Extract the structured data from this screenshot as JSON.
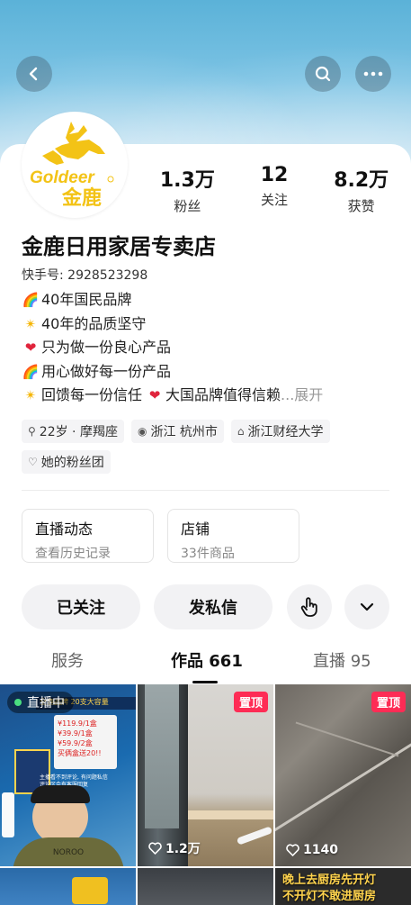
{
  "header": {
    "back_icon": "back-arrow-icon",
    "search_icon": "search-icon",
    "more_icon": "more-dots-icon"
  },
  "profile": {
    "logo_text": "Goldeer",
    "logo_cn": "金鹿",
    "stats": [
      {
        "num": "1.3万",
        "label": "粉丝"
      },
      {
        "num": "12",
        "label": "关注"
      },
      {
        "num": "8.2万",
        "label": "获赞"
      }
    ],
    "name": "金鹿日用家居专卖店",
    "kuaishou_id": "快手号: 2928523298",
    "bio": [
      "40年国民品牌",
      "40年的品质坚守",
      "只为做一份良心产品",
      "用心做好每一份产品"
    ],
    "bio_last_a": "回馈每一份信任",
    "bio_last_b": "大国品牌值得信赖",
    "bio_more": "...展开",
    "tags": [
      "22岁 · 摩羯座",
      "浙江 杭州市",
      "浙江财经大学"
    ],
    "fan_group": "她的粉丝团"
  },
  "boxes": {
    "live": {
      "title": "直播动态",
      "sub": "查看历史记录"
    },
    "shop": {
      "title": "店铺",
      "sub": "33件商品"
    }
  },
  "actions": {
    "followed": "已关注",
    "message": "发私信"
  },
  "tabs": [
    {
      "label": "服务"
    },
    {
      "label": "作品 661"
    },
    {
      "label": "直播 95"
    }
  ],
  "grid": {
    "live_badge": "直播中",
    "thumb1_text": [
      "全鹿品牌 20支大容量",
      "¥119.9/1盒",
      "¥39.9/1盒",
      "¥59.9/2盒",
      "买俩盒送20!!",
      "主播看不到评论, 有问题私信",
      "评论区会有客服回复",
      "NOROO"
    ],
    "pin_label": "置顶",
    "likes": [
      "1.2万",
      "1140"
    ],
    "bottom_text": [
      "晚上去厨房先开灯",
      "不开灯不敢进厨房"
    ]
  }
}
